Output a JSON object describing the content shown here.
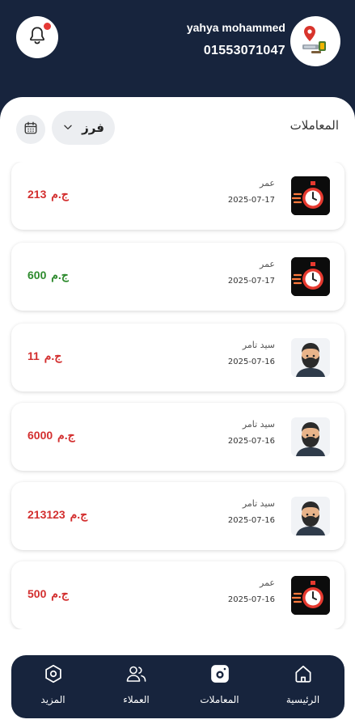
{
  "header": {
    "user_name": "yahya mohammed",
    "user_phone": "01553071047"
  },
  "transactions": {
    "title": "المعاملات",
    "filter": {
      "selected": "فرز"
    },
    "items": [
      {
        "name": "عمر",
        "date": "2025-07-17",
        "amount": "213",
        "currency": "ج.م",
        "type": "negative",
        "icon": "stopwatch-icon"
      },
      {
        "name": "عمر",
        "date": "2025-07-17",
        "amount": "600",
        "currency": "ج.م",
        "type": "positive",
        "icon": "stopwatch-icon"
      },
      {
        "name": "سيد تامر",
        "date": "2025-07-16",
        "amount": "11",
        "currency": "ج.م",
        "type": "negative",
        "icon": "bearded-man-avatar-icon"
      },
      {
        "name": "سيد تامر",
        "date": "2025-07-16",
        "amount": "6000",
        "currency": "ج.م",
        "type": "negative",
        "icon": "bearded-man-avatar-icon"
      },
      {
        "name": "سيد تامر",
        "date": "2025-07-16",
        "amount": "213123",
        "currency": "ج.م",
        "type": "negative",
        "icon": "bearded-man-avatar-icon"
      },
      {
        "name": "عمر",
        "date": "2025-07-16",
        "amount": "500",
        "currency": "ج.م",
        "type": "negative",
        "icon": "stopwatch-icon"
      }
    ]
  },
  "nav": {
    "items": [
      {
        "label": "الرئيسية",
        "icon": "home-icon"
      },
      {
        "label": "المعاملات",
        "icon": "camera-icon",
        "active": true
      },
      {
        "label": "العملاء",
        "icon": "users-icon"
      },
      {
        "label": "المزيد",
        "icon": "hexagon-settings-icon"
      }
    ]
  },
  "colors": {
    "navy": "#17243d",
    "negative": "#d32f2f",
    "positive": "#2e8b2e",
    "notification_dot": "#e53935"
  }
}
